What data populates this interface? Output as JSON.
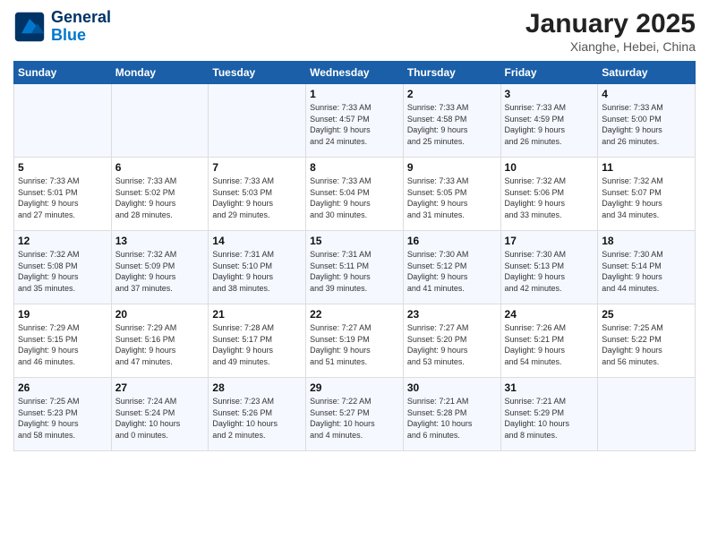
{
  "header": {
    "logo_line1": "General",
    "logo_line2": "Blue",
    "month": "January 2025",
    "location": "Xianghe, Hebei, China"
  },
  "days_of_week": [
    "Sunday",
    "Monday",
    "Tuesday",
    "Wednesday",
    "Thursday",
    "Friday",
    "Saturday"
  ],
  "weeks": [
    [
      {
        "day": "",
        "info": ""
      },
      {
        "day": "",
        "info": ""
      },
      {
        "day": "",
        "info": ""
      },
      {
        "day": "1",
        "info": "Sunrise: 7:33 AM\nSunset: 4:57 PM\nDaylight: 9 hours\nand 24 minutes."
      },
      {
        "day": "2",
        "info": "Sunrise: 7:33 AM\nSunset: 4:58 PM\nDaylight: 9 hours\nand 25 minutes."
      },
      {
        "day": "3",
        "info": "Sunrise: 7:33 AM\nSunset: 4:59 PM\nDaylight: 9 hours\nand 26 minutes."
      },
      {
        "day": "4",
        "info": "Sunrise: 7:33 AM\nSunset: 5:00 PM\nDaylight: 9 hours\nand 26 minutes."
      }
    ],
    [
      {
        "day": "5",
        "info": "Sunrise: 7:33 AM\nSunset: 5:01 PM\nDaylight: 9 hours\nand 27 minutes."
      },
      {
        "day": "6",
        "info": "Sunrise: 7:33 AM\nSunset: 5:02 PM\nDaylight: 9 hours\nand 28 minutes."
      },
      {
        "day": "7",
        "info": "Sunrise: 7:33 AM\nSunset: 5:03 PM\nDaylight: 9 hours\nand 29 minutes."
      },
      {
        "day": "8",
        "info": "Sunrise: 7:33 AM\nSunset: 5:04 PM\nDaylight: 9 hours\nand 30 minutes."
      },
      {
        "day": "9",
        "info": "Sunrise: 7:33 AM\nSunset: 5:05 PM\nDaylight: 9 hours\nand 31 minutes."
      },
      {
        "day": "10",
        "info": "Sunrise: 7:32 AM\nSunset: 5:06 PM\nDaylight: 9 hours\nand 33 minutes."
      },
      {
        "day": "11",
        "info": "Sunrise: 7:32 AM\nSunset: 5:07 PM\nDaylight: 9 hours\nand 34 minutes."
      }
    ],
    [
      {
        "day": "12",
        "info": "Sunrise: 7:32 AM\nSunset: 5:08 PM\nDaylight: 9 hours\nand 35 minutes."
      },
      {
        "day": "13",
        "info": "Sunrise: 7:32 AM\nSunset: 5:09 PM\nDaylight: 9 hours\nand 37 minutes."
      },
      {
        "day": "14",
        "info": "Sunrise: 7:31 AM\nSunset: 5:10 PM\nDaylight: 9 hours\nand 38 minutes."
      },
      {
        "day": "15",
        "info": "Sunrise: 7:31 AM\nSunset: 5:11 PM\nDaylight: 9 hours\nand 39 minutes."
      },
      {
        "day": "16",
        "info": "Sunrise: 7:30 AM\nSunset: 5:12 PM\nDaylight: 9 hours\nand 41 minutes."
      },
      {
        "day": "17",
        "info": "Sunrise: 7:30 AM\nSunset: 5:13 PM\nDaylight: 9 hours\nand 42 minutes."
      },
      {
        "day": "18",
        "info": "Sunrise: 7:30 AM\nSunset: 5:14 PM\nDaylight: 9 hours\nand 44 minutes."
      }
    ],
    [
      {
        "day": "19",
        "info": "Sunrise: 7:29 AM\nSunset: 5:15 PM\nDaylight: 9 hours\nand 46 minutes."
      },
      {
        "day": "20",
        "info": "Sunrise: 7:29 AM\nSunset: 5:16 PM\nDaylight: 9 hours\nand 47 minutes."
      },
      {
        "day": "21",
        "info": "Sunrise: 7:28 AM\nSunset: 5:17 PM\nDaylight: 9 hours\nand 49 minutes."
      },
      {
        "day": "22",
        "info": "Sunrise: 7:27 AM\nSunset: 5:19 PM\nDaylight: 9 hours\nand 51 minutes."
      },
      {
        "day": "23",
        "info": "Sunrise: 7:27 AM\nSunset: 5:20 PM\nDaylight: 9 hours\nand 53 minutes."
      },
      {
        "day": "24",
        "info": "Sunrise: 7:26 AM\nSunset: 5:21 PM\nDaylight: 9 hours\nand 54 minutes."
      },
      {
        "day": "25",
        "info": "Sunrise: 7:25 AM\nSunset: 5:22 PM\nDaylight: 9 hours\nand 56 minutes."
      }
    ],
    [
      {
        "day": "26",
        "info": "Sunrise: 7:25 AM\nSunset: 5:23 PM\nDaylight: 9 hours\nand 58 minutes."
      },
      {
        "day": "27",
        "info": "Sunrise: 7:24 AM\nSunset: 5:24 PM\nDaylight: 10 hours\nand 0 minutes."
      },
      {
        "day": "28",
        "info": "Sunrise: 7:23 AM\nSunset: 5:26 PM\nDaylight: 10 hours\nand 2 minutes."
      },
      {
        "day": "29",
        "info": "Sunrise: 7:22 AM\nSunset: 5:27 PM\nDaylight: 10 hours\nand 4 minutes."
      },
      {
        "day": "30",
        "info": "Sunrise: 7:21 AM\nSunset: 5:28 PM\nDaylight: 10 hours\nand 6 minutes."
      },
      {
        "day": "31",
        "info": "Sunrise: 7:21 AM\nSunset: 5:29 PM\nDaylight: 10 hours\nand 8 minutes."
      },
      {
        "day": "",
        "info": ""
      }
    ]
  ]
}
